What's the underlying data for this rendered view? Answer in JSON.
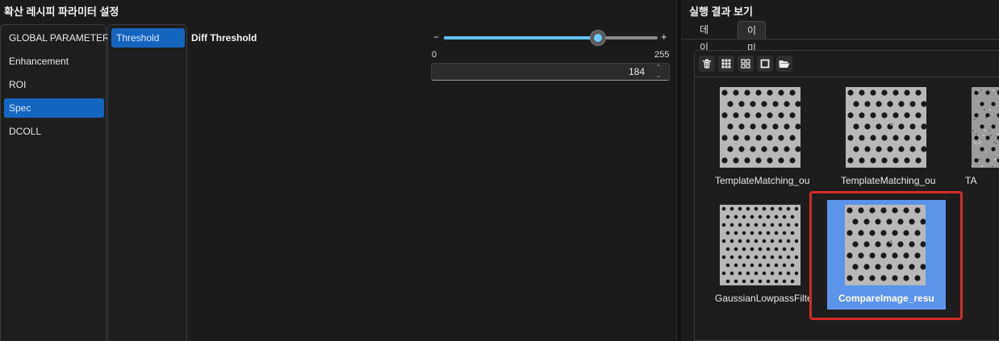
{
  "left_panel": {
    "title": "확산 레시피 파라미터 설정",
    "categories": [
      {
        "label": "GLOBAL PARAMETER",
        "selected": false
      },
      {
        "label": "Enhancement",
        "selected": false
      },
      {
        "label": "ROI",
        "selected": false
      },
      {
        "label": "Spec",
        "selected": true
      },
      {
        "label": "DCOLL",
        "selected": false
      }
    ],
    "subitems": [
      {
        "label": "Threshold",
        "selected": true
      }
    ],
    "parameter": {
      "label": "Diff Threshold",
      "minus_symbol": "−",
      "plus_symbol": "+",
      "min_label": "0",
      "max_label": "255",
      "value": "184",
      "min": 0,
      "max": 255,
      "spin_up_symbol": "⌃",
      "spin_down_symbol": "⌄"
    }
  },
  "right_panel": {
    "title": "실행 결과 보기",
    "tabs": [
      {
        "label": "데이터",
        "active": false
      },
      {
        "label": "이미지",
        "active": true
      }
    ],
    "toolbar": [
      "trash-icon",
      "grid-large-icon",
      "grid-small-icon",
      "square-icon",
      "folder-open-icon"
    ],
    "thumbnails": [
      {
        "label": "TemplateMatching_ou",
        "pattern": "square",
        "selected": false
      },
      {
        "label": "TemplateMatching_ou",
        "pattern": "square-mark",
        "selected": false
      },
      {
        "label": "TA",
        "pattern": "noise",
        "selected": false
      },
      {
        "label": "GaussianLowpassFilte",
        "pattern": "hex",
        "selected": false
      },
      {
        "label": "CompareImage_resu",
        "pattern": "square-mark",
        "selected": true
      }
    ]
  },
  "colors": {
    "accent": "#1565c0",
    "slider": "#5ec4ff",
    "selection": "#5b94ea",
    "highlight": "#d42a2a"
  }
}
